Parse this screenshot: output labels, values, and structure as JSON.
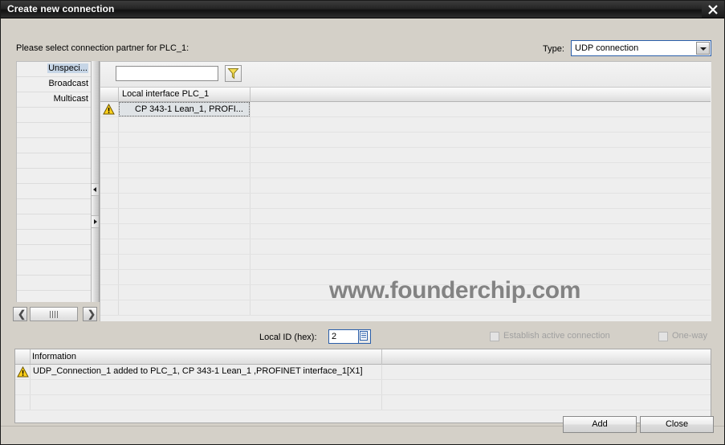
{
  "window": {
    "title": "Create new connection",
    "close_icon": "close-icon"
  },
  "header": {
    "prompt": "Please select connection partner for PLC_1:",
    "type_label": "Type:",
    "type_value": "UDP connection",
    "type_dropdown_icon": "chevron-down-icon"
  },
  "tree": {
    "items": [
      {
        "label": "Unspeci...",
        "selected": true
      },
      {
        "label": "Broadcast",
        "selected": false
      },
      {
        "label": "Multicast",
        "selected": false
      }
    ],
    "splitter_collapse_left_icon": "chevron-left-icon",
    "splitter_collapse_right_icon": "chevron-right-icon",
    "scroll_left_icon": "chevron-left-icon",
    "scroll_right_icon": "chevron-right-icon",
    "scroll_thumb_grip_icon": "grip-icon"
  },
  "list": {
    "filter_value": "",
    "filter_placeholder": "",
    "filter_button_icon": "funnel-filter-icon",
    "column_header": "Local interface PLC_1",
    "selected_row": {
      "label": "CP 343-1 Lean_1, PROFI...",
      "status_icon": "warning-icon"
    },
    "watermark": "www.founderchip.com"
  },
  "options": {
    "local_id_label": "Local ID (hex):",
    "local_id_value": "2",
    "local_id_button_icon": "value-picker-icon",
    "establish_active_label": "Establish active connection",
    "establish_active_checked": false,
    "one_way_label": "One-way",
    "one_way_checked": false
  },
  "information": {
    "column_header": "Information",
    "rows": [
      {
        "icon": "warning-icon",
        "message": "UDP_Connection_1 added to PLC_1, CP 343-1 Lean_1 ,PROFINET interface_1[X1]"
      }
    ]
  },
  "footer": {
    "add_label": "Add",
    "close_label": "Close"
  },
  "colors": {
    "titlebar": "#1a1a1a",
    "dialog_bg": "#d4d0c8",
    "panel_bg": "#eeeeee",
    "selection": "#c6d5e6",
    "focus_border": "#2b5faa",
    "warning_yellow": "#ffcc00",
    "watermark_gray": "#7b7b7b"
  }
}
